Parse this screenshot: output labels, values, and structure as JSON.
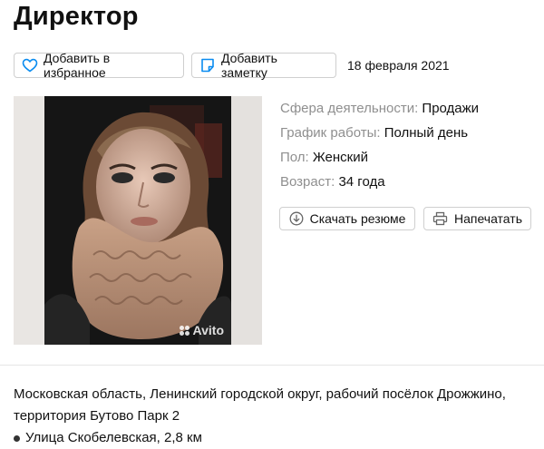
{
  "page": {
    "title": "Директор",
    "date": "18 февраля 2021"
  },
  "actions": {
    "favorite_label": "Добавить в избранное",
    "note_label": "Добавить заметку",
    "download_label": "Скачать резюме",
    "print_label": "Напечатать"
  },
  "details": [
    {
      "label": "Сфера деятельности:",
      "value": "Продажи"
    },
    {
      "label": "График работы:",
      "value": "Полный день"
    },
    {
      "label": "Пол:",
      "value": "Женский"
    },
    {
      "label": "Возраст:",
      "value": "34 года"
    }
  ],
  "photo": {
    "watermark": "Avito"
  },
  "location": {
    "address": "Московская область, Ленинский городской округ, рабочий посёлок Дрожжино, территория Бутово Парк 2",
    "metro": "Улица Скобелевская, 2,8 км"
  },
  "colors": {
    "accent_blue": "#0a8cf0",
    "label_gray": "#8f8f8f",
    "border": "#cfcfcf"
  },
  "icons": {
    "favorite": "heart-icon",
    "note": "note-icon",
    "download": "download-icon",
    "print": "printer-icon"
  }
}
